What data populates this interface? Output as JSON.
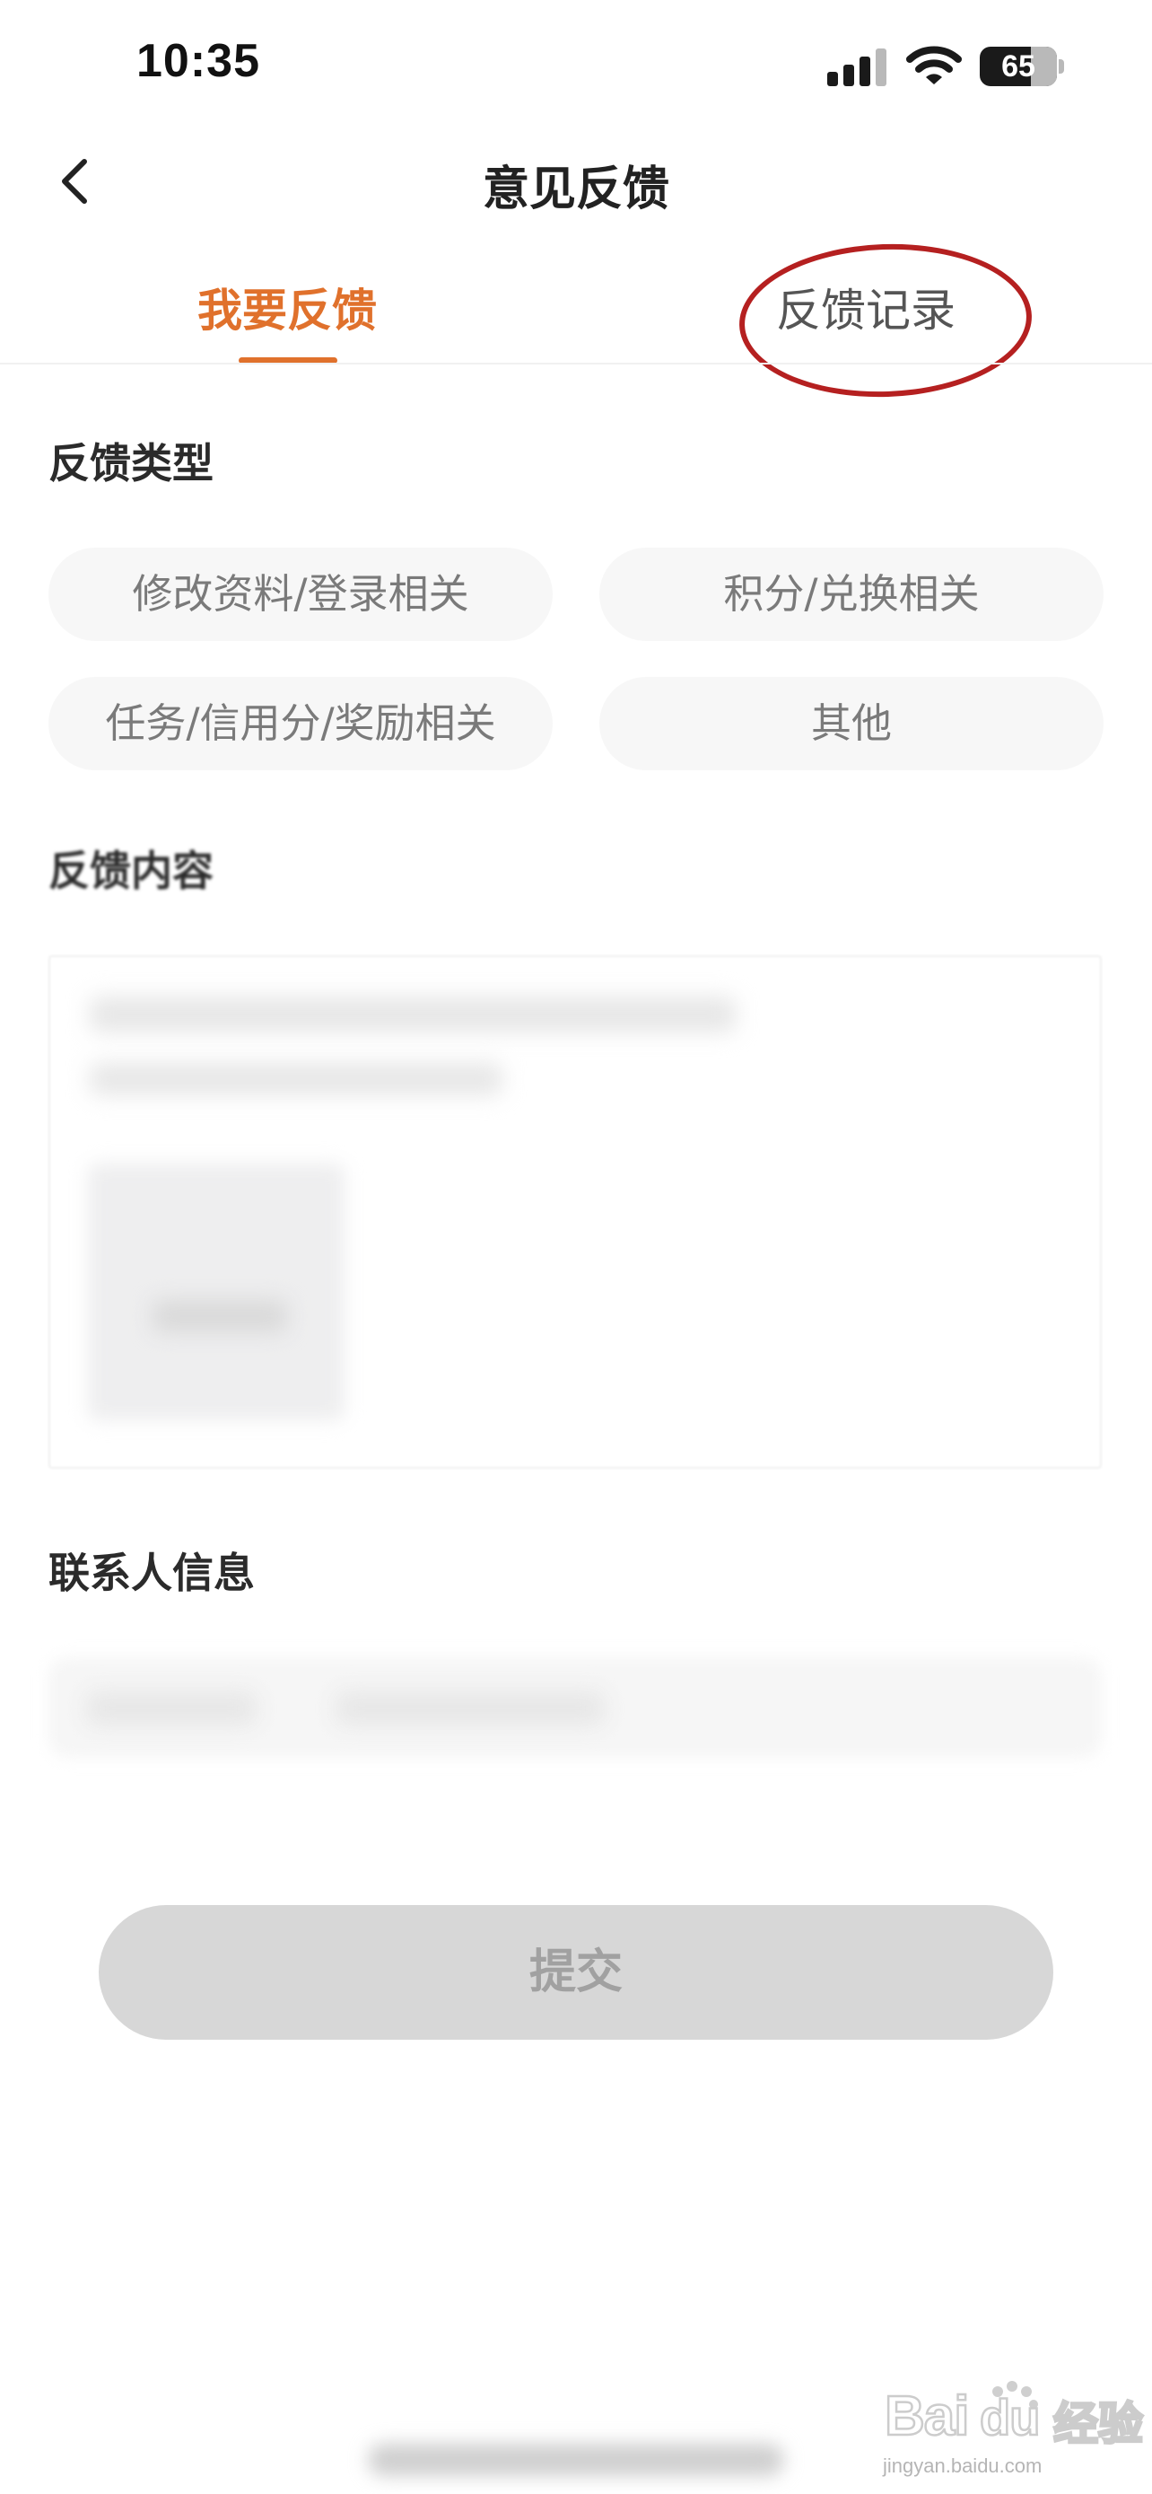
{
  "status_bar": {
    "time": "10:35",
    "battery_level": "65",
    "icons": [
      "signal-icon",
      "wifi-icon",
      "battery-icon"
    ]
  },
  "nav": {
    "title": "意见反馈",
    "back_icon": "chevron-left-icon"
  },
  "tabs": [
    {
      "label": "我要反馈",
      "active": true
    },
    {
      "label": "反馈记录",
      "active": false
    }
  ],
  "feedback_type": {
    "heading": "反馈类型",
    "options": [
      "修改资料/登录相关",
      "积分/兑换相关",
      "任务/信用分/奖励相关",
      "其他"
    ]
  },
  "feedback_content": {
    "heading": "反馈内容"
  },
  "contact_info": {
    "heading": "联系人信息"
  },
  "submit": {
    "label": "提交"
  },
  "watermark": {
    "text_cn": "经验",
    "url": "jingyan.baidu.com"
  },
  "colors": {
    "accent": "#e0712c",
    "annotation": "#b52020",
    "submit_disabled_bg": "#d7d7d7",
    "chip_bg": "#f7f7f7"
  }
}
